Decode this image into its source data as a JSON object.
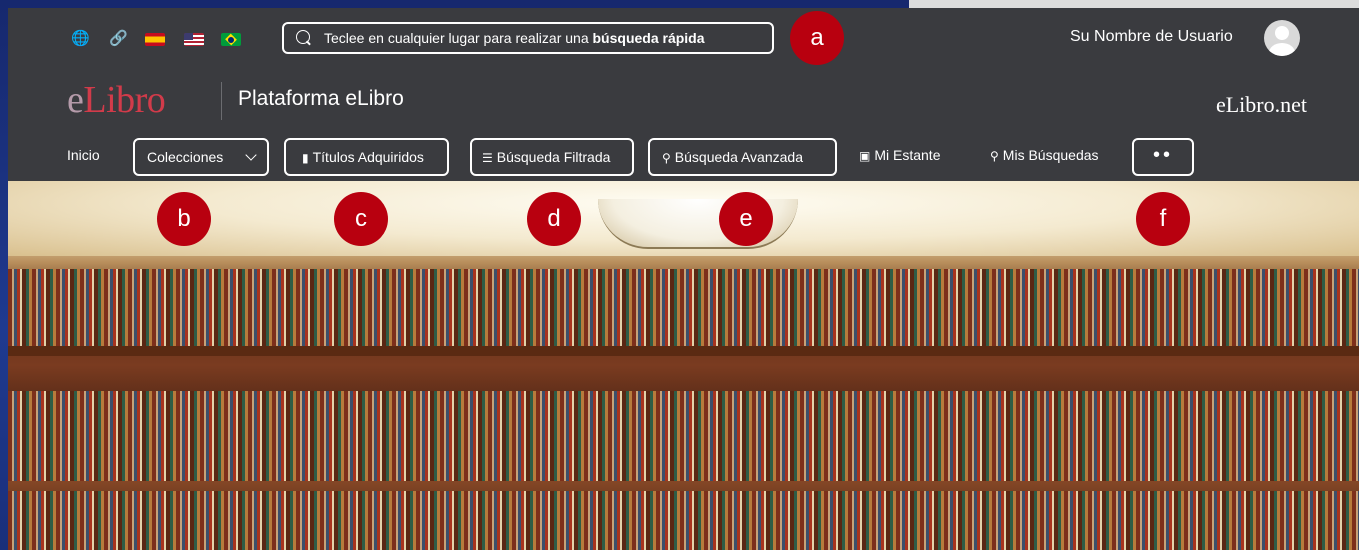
{
  "header": {
    "search_text_prefix": "Teclee en cualquier lugar para realizar una ",
    "search_text_bold": "búsqueda rápida",
    "username": "Su Nombre de Usuario"
  },
  "branding": {
    "logo_e": "e",
    "logo_rest": "Libro",
    "platform": "Plataforma eLibro",
    "brand_right": "eLibro.net"
  },
  "nav": {
    "inicio": "Inicio",
    "colecciones": "Colecciones",
    "titulos": "Títulos Adquiridos",
    "filtrada": "Búsqueda Filtrada",
    "avanzada": "Búsqueda Avanzada",
    "estante": "Mi Estante",
    "mis_busquedas": "Mis Búsquedas",
    "more": "••"
  },
  "markers": {
    "a": "a",
    "b": "b",
    "c": "c",
    "d": "d",
    "e": "e",
    "f": "f"
  },
  "icons": {
    "globe": "globe-icon",
    "link": "link-icon",
    "search": "search-icon",
    "book": "book-icon",
    "sliders": "sliders-icon",
    "bookshelf": "bookshelf-icon"
  },
  "colors": {
    "app_bg": "#3a3b3f",
    "marker_red": "#b8000f",
    "logo_red": "#d13b4a",
    "outer_blue": "#1f3a8f"
  }
}
